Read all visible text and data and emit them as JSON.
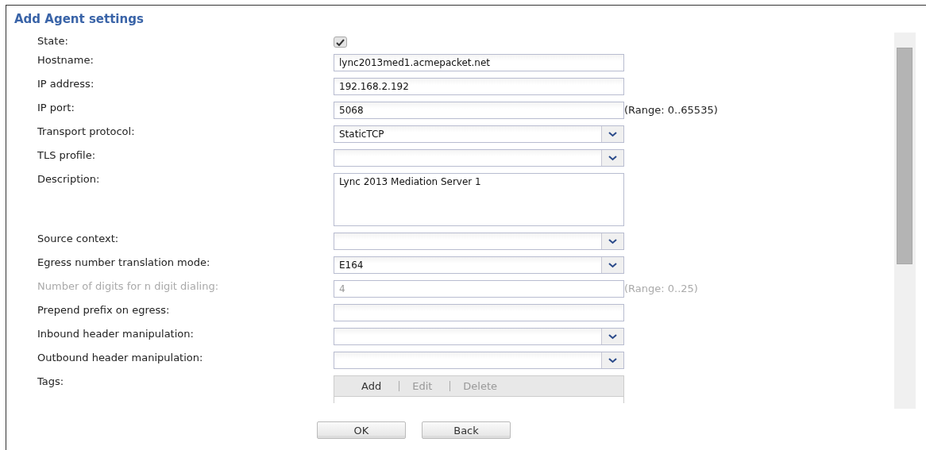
{
  "title": "Add Agent settings",
  "fields": [
    {
      "kind": "checkbox",
      "label": "State:",
      "checked": true,
      "disabled": false
    },
    {
      "kind": "text",
      "label": "Hostname:",
      "value": "lync2013med1.acmepacket.net",
      "disabled": false
    },
    {
      "kind": "text",
      "label": "IP address:",
      "value": "192.168.2.192",
      "disabled": false
    },
    {
      "kind": "text",
      "label": "IP port:",
      "value": "5068",
      "range": "(Range: 0..65535)",
      "disabled": false
    },
    {
      "kind": "select",
      "label": "Transport protocol:",
      "value": "StaticTCP",
      "disabled": false
    },
    {
      "kind": "select",
      "label": "TLS profile:",
      "disabled": false
    },
    {
      "kind": "textarea",
      "label": "Description:",
      "value": "Lync 2013 Mediation Server 1",
      "disabled": false
    },
    {
      "kind": "select",
      "label": "Source context:",
      "disabled": false
    },
    {
      "kind": "select",
      "label": "Egress number translation mode:",
      "value": "E164",
      "disabled": false
    },
    {
      "kind": "text",
      "label": "Number of digits for n digit dialing:",
      "value": "4",
      "range": "(Range: 0..25)",
      "disabled": true
    },
    {
      "kind": "text",
      "label": "Prepend prefix on egress:",
      "disabled": false
    },
    {
      "kind": "select",
      "label": "Inbound header manipulation:",
      "disabled": false
    },
    {
      "kind": "select",
      "label": "Outbound header manipulation:",
      "disabled": false
    },
    {
      "kind": "tags",
      "label": "Tags:",
      "actions": [
        {
          "label": "Add",
          "disabled": false
        },
        {
          "label": "Edit",
          "disabled": true
        },
        {
          "label": "Delete",
          "disabled": true
        }
      ]
    }
  ],
  "buttons": [
    "OK",
    "Back"
  ]
}
